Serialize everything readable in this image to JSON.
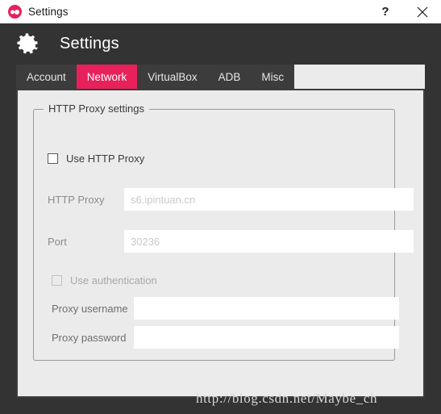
{
  "titlebar": {
    "app_name": "Settings",
    "logo_icon": "app-logo-icon",
    "help_label": "?",
    "close_icon": "close-icon"
  },
  "header": {
    "gear_icon": "gear-icon",
    "title": "Settings"
  },
  "tabs": [
    {
      "label": "Account",
      "active": false
    },
    {
      "label": "Network",
      "active": true
    },
    {
      "label": "VirtualBox",
      "active": false
    },
    {
      "label": "ADB",
      "active": false
    },
    {
      "label": "Misc",
      "active": false
    }
  ],
  "group": {
    "title": "HTTP Proxy settings",
    "use_proxy": {
      "label": "Use HTTP Proxy",
      "checked": false,
      "enabled": true
    },
    "http_proxy": {
      "label": "HTTP Proxy",
      "value": "",
      "placeholder": "s6.ipintuan.cn",
      "enabled": false
    },
    "port": {
      "label": "Port",
      "value": "",
      "placeholder": "30236",
      "enabled": false
    },
    "use_auth": {
      "label": "Use authentication",
      "checked": false,
      "enabled": false
    },
    "proxy_username": {
      "label": "Proxy username",
      "value": "",
      "placeholder": "",
      "enabled": false
    },
    "proxy_password": {
      "label": "Proxy password",
      "value": "",
      "placeholder": "",
      "enabled": false
    }
  },
  "watermark": {
    "text": "http://blog.csdn.net/Maybe_ch"
  },
  "colors": {
    "accent": "#e8205c",
    "header_bg": "#333333",
    "panel_bg": "#ebebeb",
    "tab_bg": "#3c3c3c"
  }
}
